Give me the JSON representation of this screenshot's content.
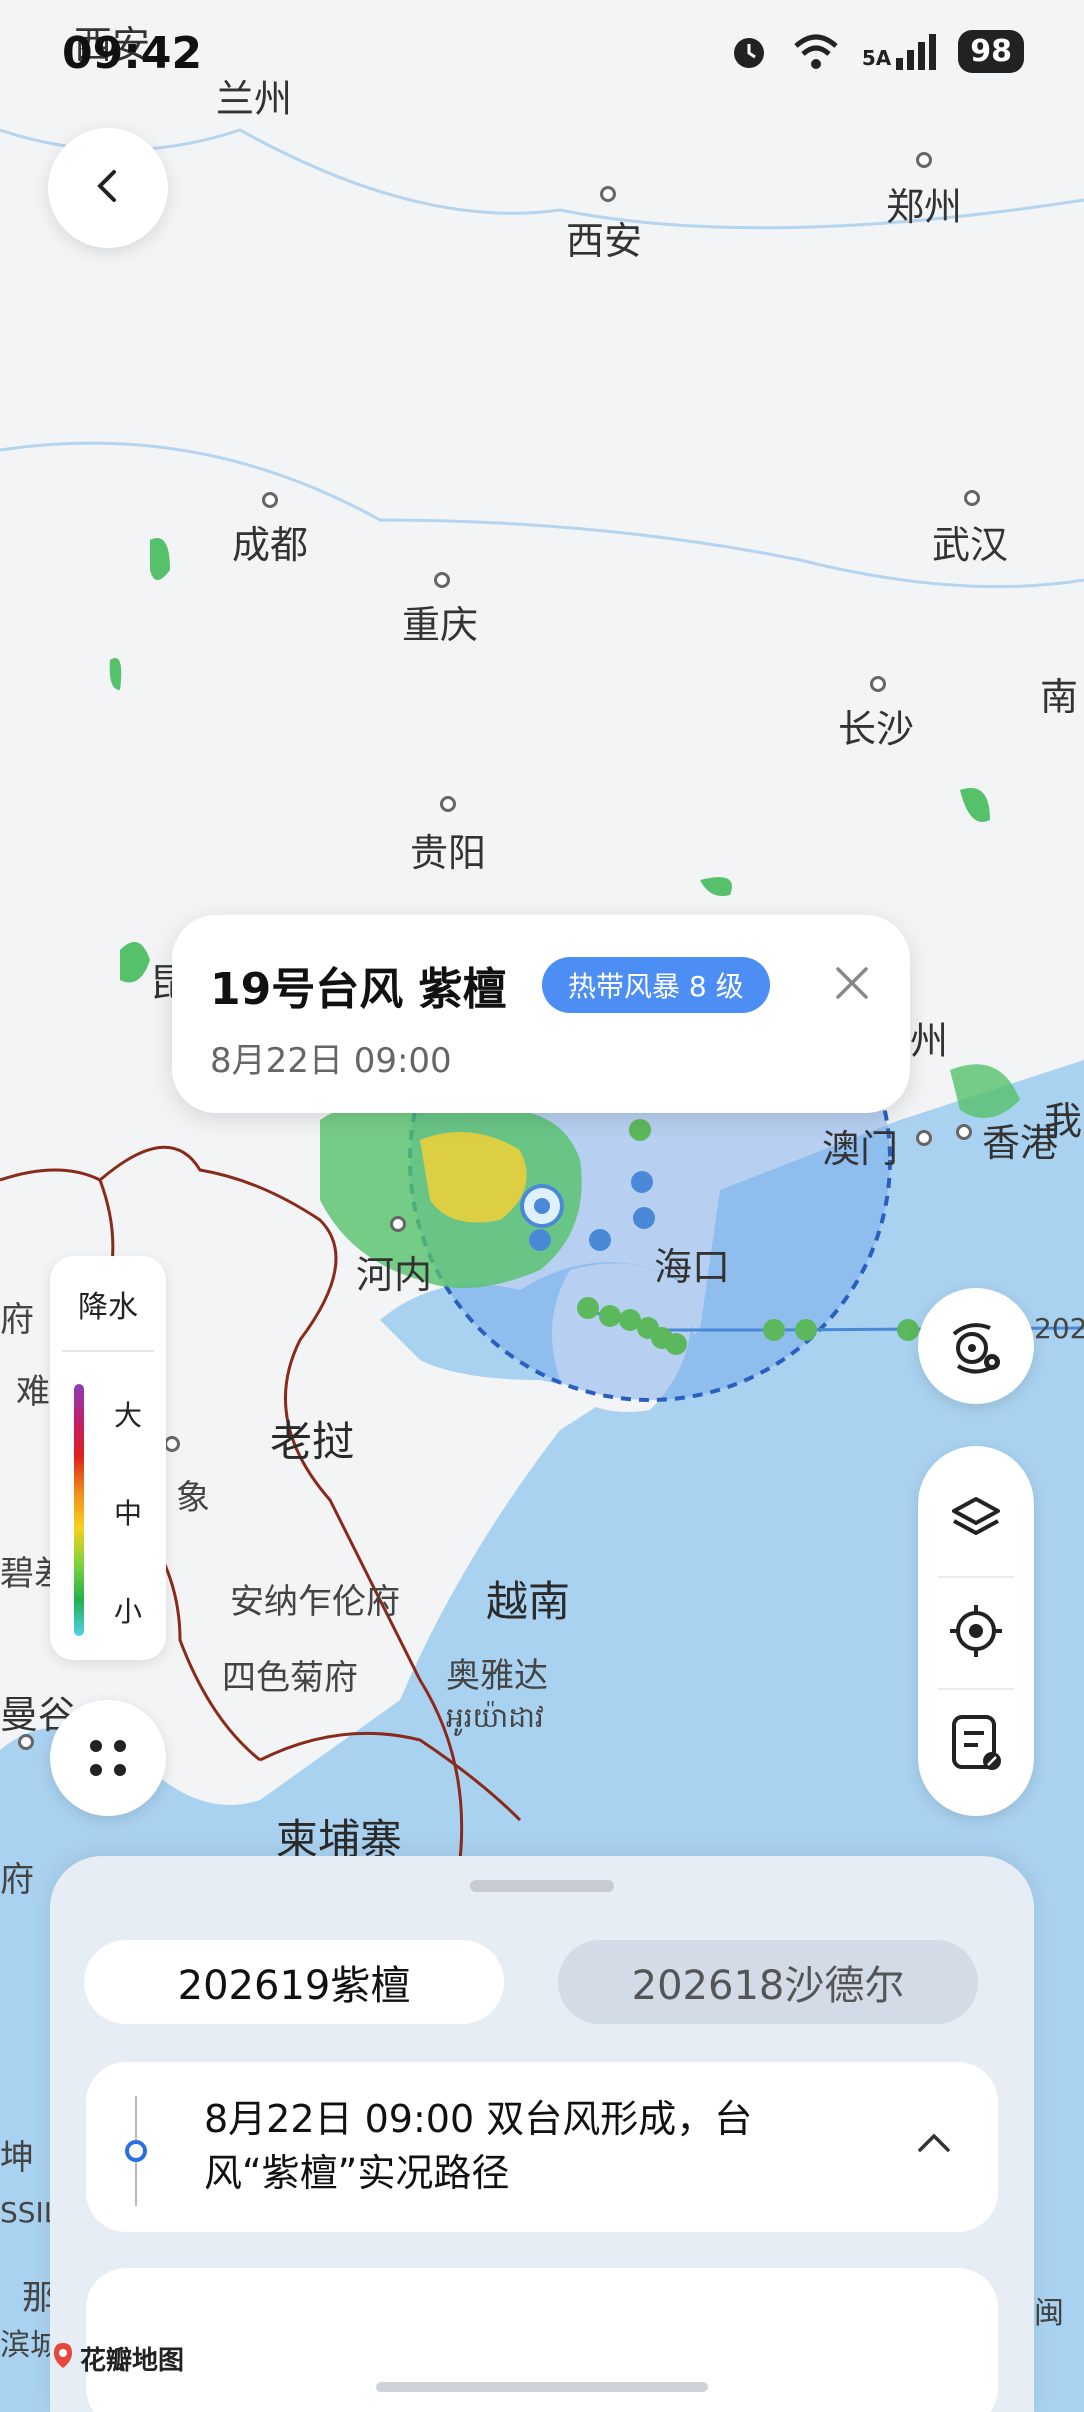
{
  "status_bar": {
    "time": "09:42",
    "network": "5A",
    "battery": "98"
  },
  "map": {
    "cities": [
      {
        "name": "西安",
        "kind": "city"
      },
      {
        "name": "兰州",
        "kind": "city"
      },
      {
        "name": "西安",
        "kind": "city"
      },
      {
        "name": "郑州",
        "kind": "city"
      },
      {
        "name": "成都",
        "kind": "city"
      },
      {
        "name": "武汉",
        "kind": "city"
      },
      {
        "name": "重庆",
        "kind": "city"
      },
      {
        "name": "长沙",
        "kind": "city"
      },
      {
        "name": "南",
        "kind": "city"
      },
      {
        "name": "贵阳",
        "kind": "city"
      },
      {
        "name": "昆",
        "kind": "city"
      },
      {
        "name": "州",
        "kind": "city"
      },
      {
        "name": "澳门",
        "kind": "city"
      },
      {
        "name": "香港",
        "kind": "city"
      },
      {
        "name": "我",
        "kind": "city"
      },
      {
        "name": "河内",
        "kind": "city"
      },
      {
        "name": "海口",
        "kind": "city"
      },
      {
        "name": "府",
        "kind": "city"
      },
      {
        "name": "难",
        "kind": "city"
      },
      {
        "name": "老挝",
        "kind": "country"
      },
      {
        "name": "象",
        "kind": "city"
      },
      {
        "name": "碧差",
        "kind": "city"
      },
      {
        "name": "越南",
        "kind": "country"
      },
      {
        "name": "安纳乍伦府",
        "kind": "small"
      },
      {
        "name": "四色菊府",
        "kind": "small"
      },
      {
        "name": "奥雅达",
        "kind": "small"
      },
      {
        "name": "អូរយ៉ាដាវ",
        "kind": "small"
      },
      {
        "name": "曼谷",
        "kind": "city"
      },
      {
        "name": "柬埔寨",
        "kind": "country"
      },
      {
        "name": "府",
        "kind": "city"
      },
      {
        "name": "坤",
        "kind": "city"
      },
      {
        "name": "SSIL",
        "kind": "small"
      },
      {
        "name": "那",
        "kind": "city"
      },
      {
        "name": "滨城",
        "kind": "small"
      },
      {
        "name": "南闽",
        "kind": "small"
      },
      {
        "name": "202",
        "kind": "small"
      }
    ]
  },
  "popup": {
    "title": "19号台风 紫檀",
    "badge": "热带风暴 8 级",
    "time": "8月22日 09:00"
  },
  "legend": {
    "title": "降水",
    "high": "大",
    "mid": "中",
    "low": "小"
  },
  "sheet": {
    "tabs": [
      {
        "label": "202619紫檀",
        "active": true
      },
      {
        "label": "202618沙德尔",
        "active": false
      }
    ],
    "info": "8月22日 09:00 双台风形成，台风“紫檀”实况路径"
  },
  "brand": "花瓣地图",
  "icons": {
    "back": "chevron-left-icon",
    "close": "close-icon",
    "grid": "grid-dots-icon",
    "typhoon_settings": "typhoon-settings-icon",
    "layers": "layers-icon",
    "locate": "locate-icon",
    "notes": "notes-icon",
    "collapse": "chevron-up-icon"
  },
  "colors": {
    "accent": "#4d8ef5",
    "sea": "#a9d2f0",
    "land": "#f2f4f6",
    "border": "#8a2a1a",
    "track": "#5cb85c"
  }
}
